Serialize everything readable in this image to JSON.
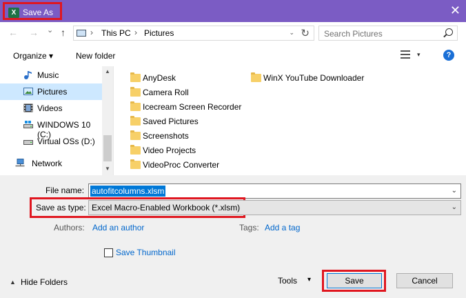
{
  "window": {
    "title": "Save As",
    "app_icon_letter": "X",
    "close_glyph": "✕"
  },
  "navigation": {
    "back_glyph": "←",
    "forward_glyph": "→",
    "dropdown_glyph": "⌄",
    "up_glyph": "↑"
  },
  "address": {
    "crumbs": [
      "This PC",
      "Pictures"
    ],
    "separator": "›",
    "dropdown_glyph": "⌄",
    "refresh_glyph": "↻"
  },
  "search": {
    "placeholder": "Search Pictures"
  },
  "toolbar": {
    "organize_label": "Organize ▾",
    "new_folder_label": "New folder",
    "view_dropdown_glyph": "▾",
    "help_label": "?"
  },
  "sidebar": {
    "items": [
      {
        "label": "Music",
        "icon": "music-icon",
        "selected": false
      },
      {
        "label": "Pictures",
        "icon": "pictures-icon",
        "selected": true
      },
      {
        "label": "Videos",
        "icon": "videos-icon",
        "selected": false
      },
      {
        "label": "WINDOWS 10 (C:)",
        "icon": "drive-icon",
        "selected": false
      },
      {
        "label": "Virtual OSs (D:)",
        "icon": "drive-icon",
        "selected": false
      },
      {
        "label": "Network",
        "icon": "network-icon",
        "selected": false
      }
    ],
    "scroll_up_glyph": "▲",
    "scroll_down_glyph": "▼"
  },
  "files": {
    "column1": [
      "AnyDesk",
      "Camera Roll",
      "Icecream Screen Recorder",
      "Saved Pictures",
      "Screenshots",
      "Video Projects",
      "VideoProc Converter"
    ],
    "column2": [
      "WinX YouTube Downloader"
    ]
  },
  "form": {
    "file_name_label": "File name:",
    "file_name_value": "autofitcolumns.xlsm",
    "save_as_type_label": "Save as type:",
    "save_as_type_value": "Excel Macro-Enabled Workbook (*.xlsm)",
    "dropdown_glyph": "⌄",
    "authors_label": "Authors:",
    "add_author_link": "Add an author",
    "tags_label": "Tags:",
    "add_tag_link": "Add a tag",
    "save_thumbnail_label": "Save Thumbnail"
  },
  "footer": {
    "hide_folders_label": "Hide Folders",
    "hide_folders_glyph": "▲",
    "tools_label": "Tools",
    "tools_glyph": "▾",
    "save_button": "Save",
    "cancel_button": "Cancel"
  },
  "colors": {
    "titlebar": "#7b5cc4",
    "highlight_outline": "#e0161f",
    "selection": "#0078d7",
    "link": "#0066cc",
    "sidebar_selected": "#cde8ff",
    "folder": "#f7d068"
  }
}
